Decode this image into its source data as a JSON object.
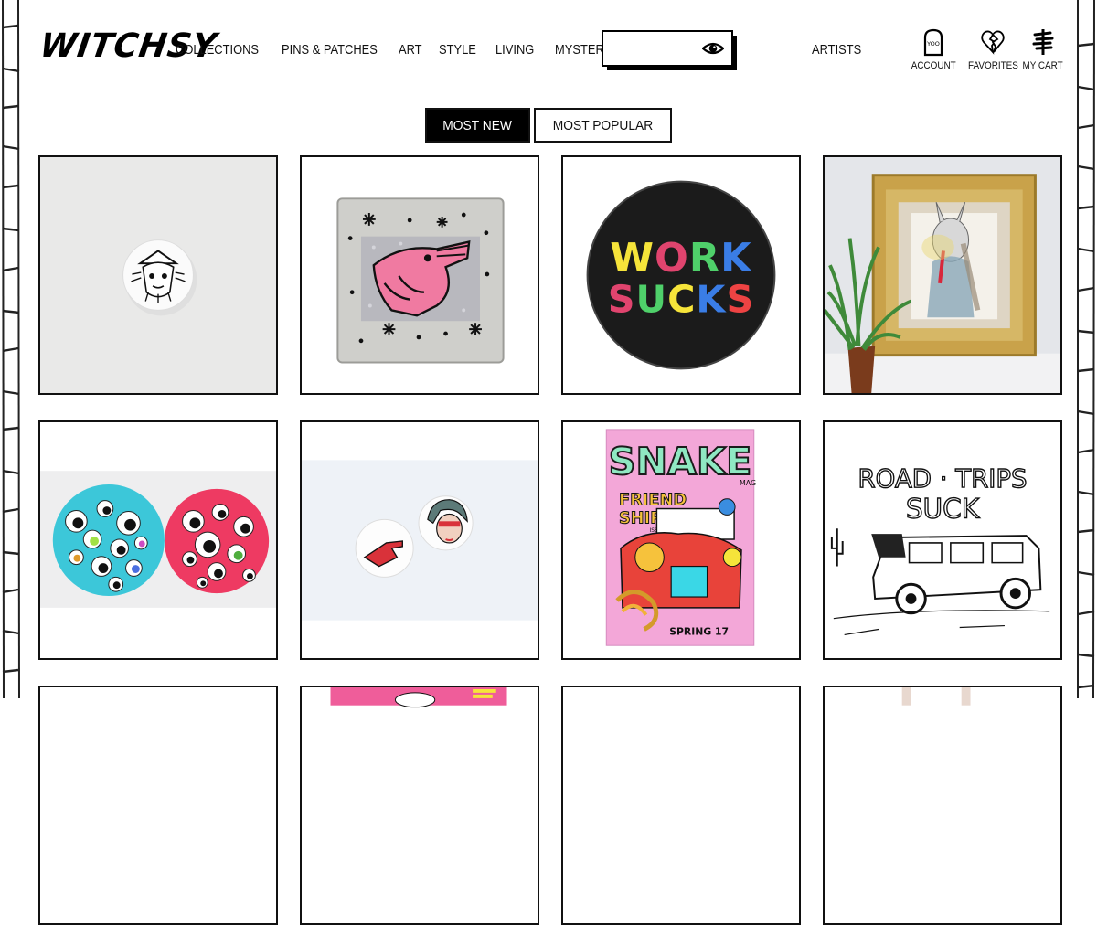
{
  "header": {
    "logo": "WITCHSY",
    "nav": [
      "COLLECTIONS",
      "PINS & PATCHES",
      "ART",
      "STYLE",
      "LIVING",
      "MYSTERY PIT"
    ],
    "search": {
      "value": "",
      "placeholder": ""
    },
    "artists": "ARTISTS",
    "account_label": "ACCOUNT",
    "favorites_label": "FAVORITES",
    "cart_label": "MY CART"
  },
  "sort": {
    "most_new": "MOST NEW",
    "most_popular": "MOST POPULAR",
    "active": "most_new"
  },
  "products": [
    {
      "art": "witch-cat-pin"
    },
    {
      "art": "crocodile-compact-mirror",
      "stars": true
    },
    {
      "art": "work-sucks-button",
      "text_line1": "WORK",
      "text_line2": "SUCKS"
    },
    {
      "art": "bunny-girl-framed-print"
    },
    {
      "art": "googly-eye-coasters"
    },
    {
      "art": "hand-and-face-pins"
    },
    {
      "art": "snake-mag-zine",
      "title": "SNAKE",
      "subtitle1": "FRIEND",
      "subtitle2": "SHIP",
      "issue": "ISSUE",
      "spring": "SPRING 17",
      "mag": "MAG"
    },
    {
      "art": "road-trips-suck-print",
      "text_line1": "ROAD · TRIPS",
      "text_line2": "SUCK"
    }
  ],
  "colors": {
    "accent": "#000000",
    "page_bg": "#ffffff"
  }
}
